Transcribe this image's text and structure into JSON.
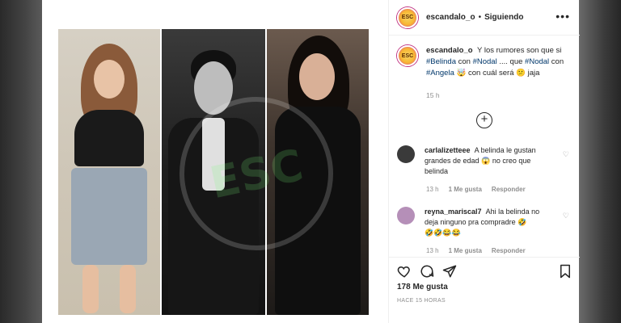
{
  "post": {
    "username": "escandalo_o",
    "follow_status": "Siguiendo",
    "avatar_text": "ESC",
    "caption": {
      "username": "escandalo_o",
      "text_1": "Y los rumores son que si",
      "tag_1": "#Belinda",
      "text_2": "con",
      "tag_2": "#Nodal",
      "text_3": ".... que",
      "tag_3": "#Nodal",
      "text_4": "con",
      "tag_4": "#Angela",
      "emoji_1": "🤯",
      "text_5": "con cuál será",
      "emoji_2": "😕",
      "text_6": "jaja",
      "time": "15 h"
    },
    "watermark_text": "ESC"
  },
  "comments": [
    {
      "username": "carlalizetteee",
      "text": "A belinda le gustan grandes de edad",
      "emoji": "😱",
      "text_end": "no creo que belinda",
      "time": "13 h",
      "likes": "1 Me gusta",
      "reply": "Responder",
      "avatar_color": "#3a3a3a"
    },
    {
      "username": "reyna_mariscal7",
      "text": "Ahi la belinda no deja ninguno pra compradre",
      "emoji": "🤣",
      "emoji_row": "🤣🤣😂😂",
      "time": "13 h",
      "likes": "1 Me gusta",
      "reply": "Responder",
      "avatar_color": "#b58fb8"
    }
  ],
  "actions": {
    "like_icon": "heart-icon",
    "comment_icon": "comment-icon",
    "share_icon": "share-icon",
    "save_icon": "bookmark-icon"
  },
  "stats": {
    "likes": "178 Me gusta",
    "ago": "HACE 15 HORAS"
  },
  "colors": {
    "link": "#00376b",
    "muted": "#8e8e8e",
    "text": "#262626"
  }
}
